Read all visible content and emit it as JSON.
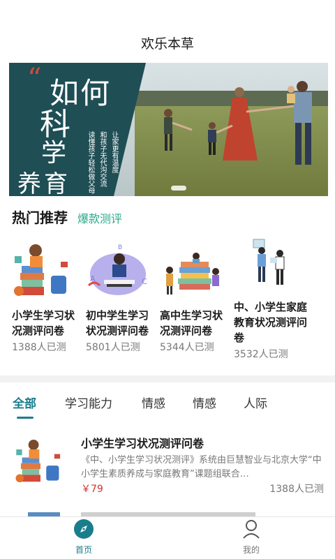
{
  "app": {
    "title": "欢乐本草"
  },
  "banner": {
    "quote_mark": "“",
    "big_lines": [
      "如何",
      "科",
      "学",
      "养育"
    ],
    "col1": "让家更有温度",
    "col2": "和孩子无代沟交流",
    "col3": "读懂孩子轻松做父母",
    "colors": {
      "panel": "#1f4e55",
      "accent": "#d24b3a"
    }
  },
  "hot": {
    "title": "热门推荐",
    "subtitle": "爆款测评",
    "items": [
      {
        "name": "小学生学习状况测评问卷",
        "count": "1388人已测",
        "icon": "boy-reading-books-illustration"
      },
      {
        "name": "初中学生学习状况测评问卷",
        "count": "5801人已测",
        "icon": "student-with-laptop-illustration"
      },
      {
        "name": "高中生学习状况测评问卷",
        "count": "5344人已测",
        "icon": "students-on-books-illustration"
      },
      {
        "name": "中、小学生家庭教育状况测评问卷",
        "count": "3532人已测",
        "icon": "parents-presentation-illustration"
      }
    ]
  },
  "tabs": [
    "全部",
    "学习能力",
    "情感",
    "情感",
    "人际"
  ],
  "list": [
    {
      "name": "小学生学习状况测评问卷",
      "desc": "《中、小学生学习状况测评》系统由巨慧智业与北京大学“中小学生素质养成与家庭教育”课题组联合…",
      "price": "￥79",
      "count": "1388人已测"
    }
  ],
  "tabbar": {
    "home": "首页",
    "me": "我的"
  },
  "colors": {
    "accent": "#1a7d8c",
    "green": "#2aa88a",
    "price": "#d9302c"
  }
}
